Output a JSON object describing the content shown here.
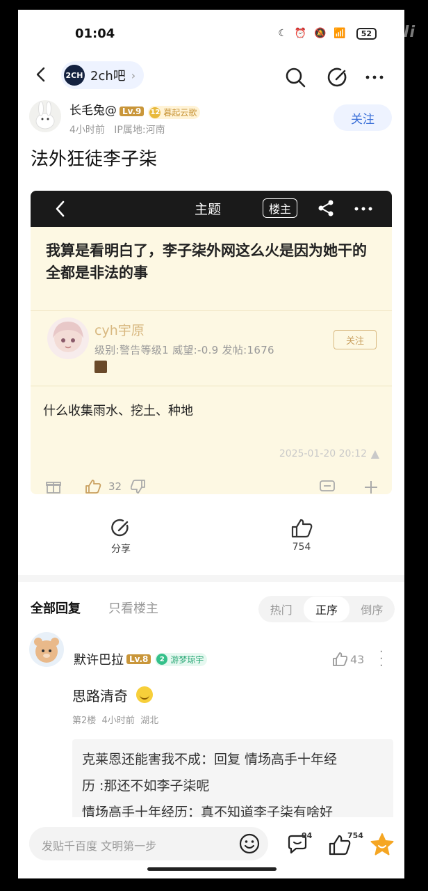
{
  "status": {
    "time": "01:04",
    "battery": "52"
  },
  "watermark": "bilibili",
  "forum": {
    "logo": "2CH",
    "name": "2ch吧"
  },
  "post": {
    "author": "长毛兔@",
    "level": "Lv.9",
    "badge": "暮起云歌",
    "badge_level": "12",
    "time": "4小时前",
    "ip": "IP属地:河南",
    "follow_label": "关注",
    "title": "法外狂徒李子柒"
  },
  "card": {
    "header_title": "主题",
    "louzhu_label": "楼主",
    "question": "我算是看明白了，李子柒外网这么火是因为她干的全都是非法的事",
    "user": "cyh宇原",
    "stats": "级别:警告等级1  威望:-0.9  发帖:1676",
    "follow_label": "关注",
    "body": "什么收集雨水、挖土、种地",
    "date": "2025-01-20 20:12",
    "like_count": "32"
  },
  "actions": {
    "share_label": "分享",
    "like_count": "754"
  },
  "tabs": {
    "all": "全部回复",
    "op_only": "只看楼主",
    "sort": [
      "热门",
      "正序",
      "倒序"
    ],
    "active_sort": "正序"
  },
  "reply": {
    "user": "默许巴拉",
    "level": "Lv.8",
    "badge": "游梦琼宇",
    "badge_level": "2",
    "like_count": "43",
    "text": "思路清奇",
    "floor": "第2楼",
    "time": "4小时前",
    "location": "湖北",
    "quote_line1": "克莱恩还能害我不成：回复 情场高手十年经",
    "quote_line2": "历 :那还不如李子柒呢",
    "quote_line3": "情场高手十年经历：真不知道李子柒有啥好"
  },
  "bottom": {
    "placeholder": "发贴千百度 文明第一步",
    "comment_count": "94",
    "like_count": "754"
  },
  "colors": {
    "accent": "#3a6fd8",
    "level": "#c9963a",
    "card_bg": "#fdf8e3",
    "star": "#f5a623"
  }
}
